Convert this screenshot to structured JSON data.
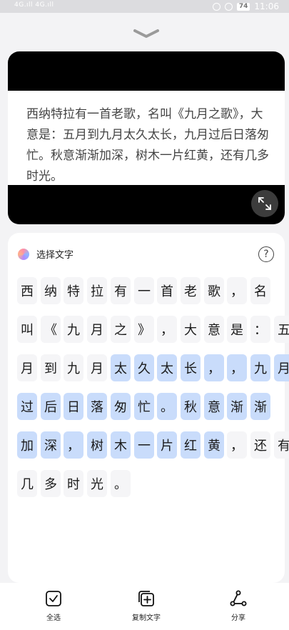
{
  "status_bar": {
    "signal_left": "4G.ıll 4G.ıll",
    "battery": "74",
    "time": "11:06"
  },
  "preview": {
    "text": "西纳特拉有一首老歌，名叫《九月之歌》，大意是：五月到九月太久太长，九月过后日落匆忙。秋意渐渐加深，树木一片红黄，还有几多时光。"
  },
  "panel": {
    "title": "选择文字",
    "help": "?",
    "rows": [
      [
        {
          "t": "西",
          "s": false
        },
        {
          "t": "纳",
          "s": false
        },
        {
          "t": "特",
          "s": false
        },
        {
          "t": "拉",
          "s": false
        },
        {
          "t": "有",
          "s": false
        },
        {
          "t": "一",
          "s": false
        },
        {
          "t": "首",
          "s": false
        },
        {
          "t": "老",
          "s": false
        },
        {
          "t": "歌",
          "s": false
        },
        {
          "t": "，",
          "s": false
        },
        {
          "t": "名",
          "s": false
        }
      ],
      [
        {
          "t": "叫",
          "s": false
        },
        {
          "t": "《",
          "s": false
        },
        {
          "t": "九",
          "s": false
        },
        {
          "t": "月",
          "s": false
        },
        {
          "t": "之",
          "s": false
        },
        {
          "t": "》",
          "s": false
        },
        {
          "t": "，",
          "s": false
        },
        {
          "t": "大",
          "s": false
        },
        {
          "t": "意",
          "s": false
        },
        {
          "t": "是",
          "s": false
        },
        {
          "t": "：",
          "s": false
        },
        {
          "t": "五",
          "s": false
        }
      ],
      [
        {
          "t": "月",
          "s": false
        },
        {
          "t": "到",
          "s": false
        },
        {
          "t": "九",
          "s": false
        },
        {
          "t": "月",
          "s": false
        },
        {
          "t": "太",
          "s": true
        },
        {
          "t": "久",
          "s": true
        },
        {
          "t": "太",
          "s": true
        },
        {
          "t": "长",
          "s": true
        },
        {
          "t": "，",
          "s": true
        },
        {
          "t": "，",
          "s": true
        },
        {
          "t": "九",
          "s": true
        },
        {
          "t": "月",
          "s": true
        }
      ],
      [
        {
          "t": "过",
          "s": true
        },
        {
          "t": "后",
          "s": true
        },
        {
          "t": "日",
          "s": true
        },
        {
          "t": "落",
          "s": true
        },
        {
          "t": "匆",
          "s": true
        },
        {
          "t": "忙",
          "s": true
        },
        {
          "t": "。",
          "s": true
        },
        {
          "t": "秋",
          "s": true
        },
        {
          "t": "意",
          "s": true
        },
        {
          "t": "渐",
          "s": true
        },
        {
          "t": "渐",
          "s": true
        }
      ],
      [
        {
          "t": "加",
          "s": true
        },
        {
          "t": "深",
          "s": true
        },
        {
          "t": "，",
          "s": true
        },
        {
          "t": "树",
          "s": true
        },
        {
          "t": "木",
          "s": true
        },
        {
          "t": "一",
          "s": true
        },
        {
          "t": "片",
          "s": true
        },
        {
          "t": "红",
          "s": true
        },
        {
          "t": "黄",
          "s": true
        },
        {
          "t": "，",
          "s": false
        },
        {
          "t": "还",
          "s": false
        },
        {
          "t": "有",
          "s": false
        }
      ],
      [
        {
          "t": "几",
          "s": false
        },
        {
          "t": "多",
          "s": false
        },
        {
          "t": "时",
          "s": false
        },
        {
          "t": "光",
          "s": false
        },
        {
          "t": "。",
          "s": false
        }
      ]
    ]
  },
  "bottom_bar": {
    "select_all": "全选",
    "copy_text": "复制文字",
    "share": "分享"
  },
  "colors": {
    "selected": "#c9dcfb",
    "unselected": "#f5f5f7"
  },
  "icons": [
    "chevron-down-icon",
    "expand-icon",
    "help-icon",
    "checkbox-icon",
    "copy-icon",
    "share-icon"
  ]
}
